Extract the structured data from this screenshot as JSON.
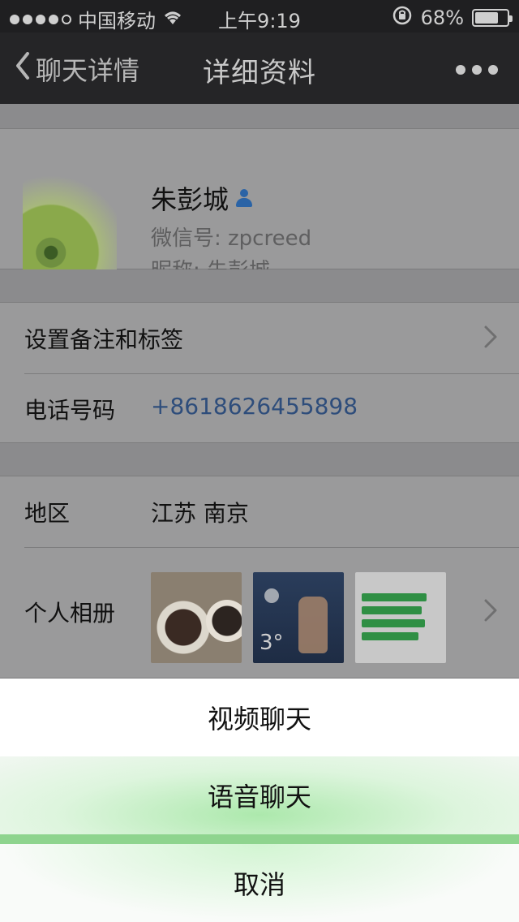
{
  "status_bar": {
    "carrier": "中国移动",
    "time": "上午9:19",
    "battery": "68%",
    "battery_fraction": 0.68,
    "signal_filled": 4,
    "signal_total": 5
  },
  "nav": {
    "back_label": "聊天详情",
    "title": "详细资料",
    "more_icon": "more-horizontal-icon"
  },
  "profile": {
    "name": "朱彭城",
    "wechat_id": "微信号: zpcreed",
    "nickname": "昵称: 朱彭城"
  },
  "rows": {
    "remark_label": "设置备注和标签",
    "phone_label": "电话号码",
    "phone_value": "+8618626455898",
    "region_label": "地区",
    "region_value": "江苏 南京",
    "album_label": "个人相册",
    "album_thumb_temp": "3°"
  },
  "action_sheet": {
    "video": "视频聊天",
    "audio": "语音聊天",
    "cancel": "取消"
  },
  "colors": {
    "link_blue": "#2e4d7b",
    "sheet_green": "#8ed48e",
    "user_icon_blue": "#2a63a6"
  }
}
